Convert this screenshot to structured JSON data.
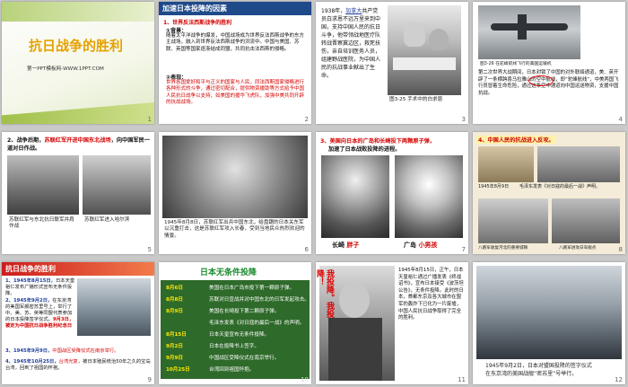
{
  "s1": {
    "title": "抗日战争的胜利",
    "sub": "第一PPT模板网-WWW.1PPT.COM",
    "num": "1"
  },
  "s2": {
    "title": "加速日本投降的因素",
    "h1": "1、世界反法西斯战争的胜利",
    "bg": "①背景：",
    "p1": "随着太平洋战争的爆发，中国战场成为世界反法西斯战争的东方主战场，融入到世界反法西斯战争的洪流中。中国与美国、苏联、英国等国家逐渐结成同盟，共同抗击法西斯的侵略。",
    "bx": "②表现：",
    "p2": "世界各国爱好和平与正义的国家与人民，同法西斯国家侵略进行各种形式的斗争，通过密切配合，提供物资援助等方式给予中国人民抗日战争以支持，如美国的援华飞虎队，加强中美共同开辟的抗战战场。",
    "num": "2"
  },
  "s3": {
    "y": "1938年，",
    "name": "加拿大",
    "p": "共产党员白求恩不远万里来到中国，支持中国人民的抗日斗争，他带领战地医疗队转战晋察冀边区，救死扶伤，亲自培训医务人员，组建野战医院，为中国人民的抗战事业献出了生命。",
    "cap": "图3-25 手术中的白求恩",
    "num": "3"
  },
  "s4": {
    "cap": "图3-26 在驼峰航线飞行的美国运输机",
    "p": "第二次世界大战期间，日本封锁了中国的对外联络通道，美、英开辟了一条横跨喜马拉雅山的空中航线，即“驼峰航线”，中美两国飞行员冒着生命危险，通过这条空中通道向中国运送物资，支援中国抗战。",
    "mark": "驼峰航线",
    "num": "4"
  },
  "s5": {
    "h": "2、战争后期，",
    "hr": "苏联红军开进中国东北战场",
    "h2": "，向中国军民一道对日作战。",
    "c1": "苏联红军与东北抗日联军并肩作战",
    "c2": "苏联红军进入哈尔滨",
    "num": "5"
  },
  "s6": {
    "cap": "1945年8月8日，苏联红军出兵中国东北，给盘踞的日本关东军以沉重打击，这是苏联红军攻入长春，受到当地民众热烈欢迎的情景。",
    "num": "6"
  },
  "s7": {
    "h": "3、美国向日本的广岛和长崎投下两颗原子弹，",
    "h2": "加速了日本战败投降的进程。",
    "l1": "长崎",
    "l1b": "胖子",
    "l2": "广岛",
    "l2b": "小男孩",
    "num": "7"
  },
  "s8": {
    "h": "4、中国人民的抗战进入反攻。",
    "c1": "1945年8月9日",
    "c2": "毛泽东发表《对日寇的最后一战》声明。",
    "c3": "八路军收复河北的重要城镇",
    "c4": "八路军进攻日军据点",
    "num": "8"
  },
  "s9": {
    "title": "抗日战争的胜利",
    "i1a": "1、1945年8月15日，",
    "i1b": "日本天皇裕仁发布广播形式宣布无条件投降。",
    "i2a": "2、1945年9月2日，",
    "i2b": "在东京湾的美国军舰密苏里号上，举行了中、美、苏、英等同盟代表参加的日本投降签字仪式。",
    "i2c": "9月3日，被定为中国抗日战争胜利纪念日",
    "i3a": "3、1945年9月9日，",
    "i3b": "中国战区受降仪式在南京举行。",
    "i4a": "4、1945年10月25日，",
    "i4b": "台湾光复，",
    "i4c": "被日本殖民统治50年之久的宝岛台湾，回到了祖国的怀抱。",
    "num": "9"
  },
  "s10": {
    "title": "日本无条件投降",
    "rows": [
      {
        "d": "8月6日",
        "e": "美国在日本广岛市投下第一颗原子弹。"
      },
      {
        "d": "8月8日",
        "e": "苏联对日宣战并对中国东北的日军发起攻击。"
      },
      {
        "d": "8月9日",
        "e": "美国在长崎投下第二颗原子弹。"
      },
      {
        "d": "",
        "e": "毛泽东发表《对日寇的最后一战》的声明。"
      },
      {
        "d": "8月15日",
        "e": "日本天皇宣布无条件投降。"
      },
      {
        "d": "9月2日",
        "e": "日本在投降书上签字。"
      },
      {
        "d": "9月9日",
        "e": "中国战区受降仪式在南京举行。"
      },
      {
        "d": "10月25日",
        "e": "台湾回到祖国怀抱。"
      }
    ],
    "num": "10"
  },
  "s11": {
    "sign": "我投降。我投降！",
    "p": "1945年8月15日，正午，日本天皇裕仁通过广播发表《终战诏书》，宣布日本接受《波茨坦公告》，无条件投降。此时的日本，首都东京及各大城市在盟军的轰炸下已化为一片废墟，中国人民抗日战争取得了完全的胜利。",
    "num": "11"
  },
  "s12": {
    "cap1": "1945年9月2日，日本对盟国投降的签字仪式",
    "cap2": "在东京湾的美国战舰“密苏里”号举行。",
    "num": "12"
  }
}
